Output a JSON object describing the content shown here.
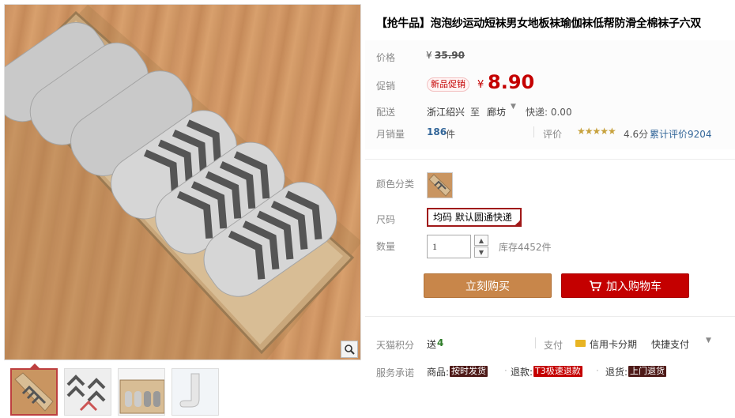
{
  "product": {
    "title": "【抢牛品】泡泡纱运动短袜男女地板袜瑜伽袜低帮防滑全棉袜子六双"
  },
  "price": {
    "label": "价格",
    "currency": "¥",
    "original": "35.90"
  },
  "promo": {
    "label": "促销",
    "badge": "新品促销",
    "currency": "¥",
    "price": "8.90"
  },
  "shipping": {
    "label": "配送",
    "from": "浙江绍兴",
    "to_word": "至",
    "destination": "廊坊",
    "fee": "快递: 0.00"
  },
  "sales": {
    "label": "月销量",
    "count": "186",
    "unit": "件",
    "review_label": "评价",
    "stars": 4.6,
    "rating": "4.6分",
    "review_total": "累计评价9204"
  },
  "sku": {
    "color_label": "颜色分类",
    "size_label": "尺码",
    "size_value": "均码 默认圆通快递",
    "qty_label": "数量",
    "qty_value": "1",
    "stock": "库存4452件"
  },
  "buttons": {
    "buy_now": "立刻购买",
    "add_to_cart": "加入购物车"
  },
  "points": {
    "label": "天猫积分",
    "prefix": "送",
    "value": "4",
    "pay_label": "支付",
    "credit": "信用卡分期",
    "quick": "快捷支付"
  },
  "service": {
    "label": "服务承诺",
    "goods_label": "商品:",
    "goods_value": "按时发货",
    "refund_label": "退款:",
    "refund_value": "T3极速退款",
    "return_label": "退货:",
    "return_value": "上门退货"
  },
  "colors": {
    "accent_red": "#c40000",
    "buy_orange": "#c8864a",
    "points_green": "#2e7c28"
  }
}
